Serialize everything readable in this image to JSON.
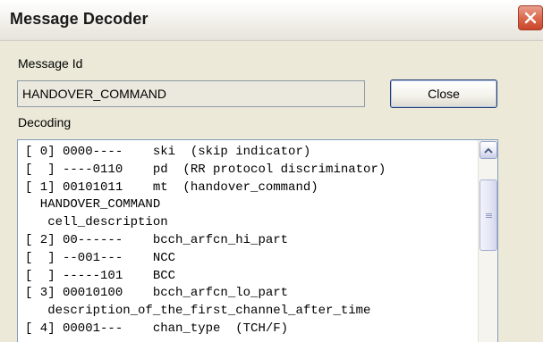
{
  "window": {
    "title": "Message Decoder",
    "close_icon": "close-x-icon"
  },
  "message_id": {
    "label": "Message Id",
    "value": "HANDOVER_COMMAND"
  },
  "close_button": {
    "label": "Close"
  },
  "decoding": {
    "label": "Decoding",
    "lines": [
      "[ 0] 0000----    ski  (skip indicator)",
      "[  ] ----0110    pd  (RR protocol discriminator)",
      "[ 1] 00101011    mt  (handover_command)",
      "  HANDOVER_COMMAND",
      "   cell_description",
      "[ 2] 00------    bcch_arfcn_hi_part",
      "[  ] --001---    NCC",
      "[  ] -----101    BCC",
      "[ 3] 00010100    bcch_arfcn_lo_part",
      "   description_of_the_first_channel_after_time",
      "[ 4] 00001---    chan_type  (TCH/F)"
    ]
  },
  "scrollbar": {
    "up_icon": "scroll-up-arrow-icon",
    "thumb_grip_icon": "grip-icon"
  }
}
